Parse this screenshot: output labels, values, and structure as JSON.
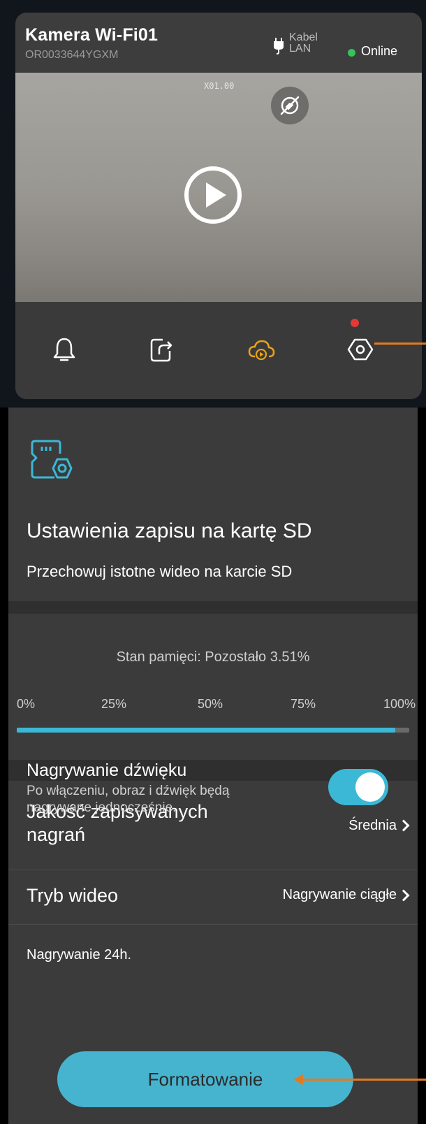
{
  "camera": {
    "name": "Kamera Wi-Fi01",
    "serial": "OR0033644YGXM",
    "connection_label": "Kabel LAN",
    "connection_icon": "ethernet-plug-icon",
    "status_label": "Online",
    "status_color": "#35c45a",
    "zoom_label": "X01.00",
    "privacy_icon": "privacy-mode-off-icon",
    "play_icon": "play-icon"
  },
  "toolbar": {
    "items": [
      {
        "icon": "bell-icon",
        "name": "alarm-button"
      },
      {
        "icon": "share-icon",
        "name": "share-button"
      },
      {
        "icon": "cloud-playback-icon",
        "name": "cloud-playback-button",
        "color": "#e8a415"
      },
      {
        "icon": "settings-icon",
        "name": "settings-button",
        "badge": true
      }
    ]
  },
  "sd_settings": {
    "icon": "sd-card-settings-icon",
    "title": "Ustawienia zapisu na kartę SD",
    "subtitle": "Przechowuj istotne wideo na karcie SD"
  },
  "memory": {
    "status_text": "Stan pamięci: Pozostało 3.51%",
    "used_percent": 96.49,
    "ticks": [
      "0%",
      "25%",
      "50%",
      "75%",
      "100%"
    ]
  },
  "quality": {
    "label": "Jakość zapisywanych nagrań",
    "value": "Średnia"
  },
  "video_mode": {
    "label": "Tryb wideo",
    "value": "Nagrywanie ciągłe"
  },
  "recording_note": "Nagrywanie 24h.",
  "audio": {
    "title": "Nagrywanie dźwięku",
    "description": "Po włączeniu, obraz i dźwięk będą nagrywane jednocześnie.",
    "enabled": true
  },
  "format_button": "Formatowanie",
  "accent_color": "#3bb8d6",
  "annotation_color": "#e07b22"
}
